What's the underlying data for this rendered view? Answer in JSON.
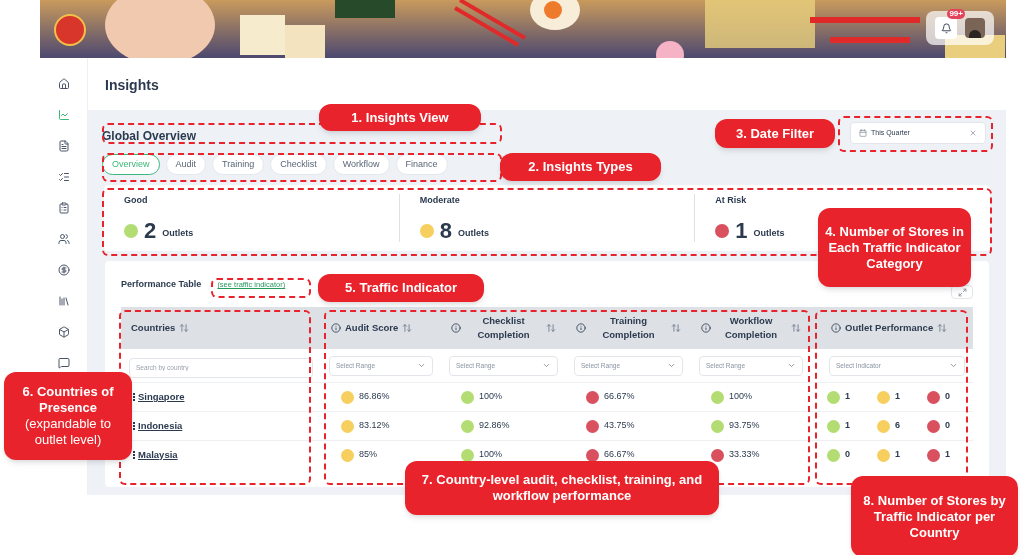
{
  "header": {
    "notification_badge": "99+"
  },
  "sidebar": {
    "items": [
      {
        "selected": false
      },
      {
        "selected": true
      },
      {
        "selected": false
      },
      {
        "selected": false
      },
      {
        "selected": false
      },
      {
        "selected": false
      },
      {
        "selected": false
      },
      {
        "selected": false
      },
      {
        "selected": false
      },
      {
        "selected": false
      }
    ]
  },
  "page_title": "Insights",
  "overview": {
    "title": "Global Overview",
    "date_filter": {
      "value": "This Quarter"
    },
    "tabs": [
      {
        "label": "Overview",
        "selected": true
      },
      {
        "label": "Audit",
        "selected": false
      },
      {
        "label": "Training",
        "selected": false
      },
      {
        "label": "Checklist",
        "selected": false
      },
      {
        "label": "Workflow",
        "selected": false
      },
      {
        "label": "Finance",
        "selected": false
      }
    ],
    "stats": [
      {
        "label": "Good",
        "count": "2",
        "unit": "Outlets",
        "color": "#b3dd73"
      },
      {
        "label": "Moderate",
        "count": "8",
        "unit": "Outlets",
        "color": "#f6cf5e"
      },
      {
        "label": "At Risk",
        "count": "1",
        "unit": "Outlets",
        "color": "#d9505f"
      }
    ]
  },
  "performance_table": {
    "title": "Performance Table",
    "link": "(see traffic indicator)",
    "columns": [
      {
        "label": "Countries",
        "info": false
      },
      {
        "label": "Audit Score",
        "info": true
      },
      {
        "label": "Checklist Completion",
        "info": true
      },
      {
        "label": "Training Completion",
        "info": true
      },
      {
        "label": "Workflow Completion",
        "info": true
      },
      {
        "label": "Outlet Performance",
        "info": true
      }
    ],
    "filters": [
      {
        "kind": "search",
        "placeholder": "Search by country"
      },
      {
        "kind": "select",
        "placeholder": "Select Range"
      },
      {
        "kind": "select",
        "placeholder": "Select Range"
      },
      {
        "kind": "select",
        "placeholder": "Select Range"
      },
      {
        "kind": "select",
        "placeholder": "Select Range"
      },
      {
        "kind": "select",
        "placeholder": "Select Indicator"
      }
    ],
    "rows": [
      {
        "cells": [
          {
            "kind": "country",
            "value": "Singapore"
          },
          {
            "kind": "metric",
            "value": "86.86%",
            "color": "#f6cf5e"
          },
          {
            "kind": "metric",
            "value": "100%",
            "color": "#b3dd73"
          },
          {
            "kind": "metric",
            "value": "66.67%",
            "color": "#d9505f"
          },
          {
            "kind": "metric",
            "value": "100%",
            "color": "#b3dd73"
          },
          {
            "kind": "outlets",
            "counts": [
              {
                "count": "1",
                "color": "#b3dd73"
              },
              {
                "count": "1",
                "color": "#f6cf5e"
              },
              {
                "count": "0",
                "color": "#d9505f"
              }
            ]
          }
        ]
      },
      {
        "cells": [
          {
            "kind": "country",
            "value": "Indonesia"
          },
          {
            "kind": "metric",
            "value": "83.12%",
            "color": "#f6cf5e"
          },
          {
            "kind": "metric",
            "value": "92.86%",
            "color": "#b3dd73"
          },
          {
            "kind": "metric",
            "value": "43.75%",
            "color": "#d9505f"
          },
          {
            "kind": "metric",
            "value": "93.75%",
            "color": "#b3dd73"
          },
          {
            "kind": "outlets",
            "counts": [
              {
                "count": "1",
                "color": "#b3dd73"
              },
              {
                "count": "6",
                "color": "#f6cf5e"
              },
              {
                "count": "0",
                "color": "#d9505f"
              }
            ]
          }
        ]
      },
      {
        "cells": [
          {
            "kind": "country",
            "value": "Malaysia"
          },
          {
            "kind": "metric",
            "value": "85%",
            "color": "#f6cf5e"
          },
          {
            "kind": "metric",
            "value": "100%",
            "color": "#b3dd73"
          },
          {
            "kind": "metric",
            "value": "66.67%",
            "color": "#d9505f"
          },
          {
            "kind": "metric",
            "value": "33.33%",
            "color": "#d9505f"
          },
          {
            "kind": "outlets",
            "counts": [
              {
                "count": "0",
                "color": "#b3dd73"
              },
              {
                "count": "1",
                "color": "#f6cf5e"
              },
              {
                "count": "1",
                "color": "#d9505f"
              }
            ]
          }
        ]
      }
    ]
  },
  "annotations": [
    {
      "text": "1. Insights View"
    },
    {
      "text": "2. Insights Types"
    },
    {
      "text": "3. Date Filter"
    },
    {
      "text": "4. Number of Stores in Each Traffic Indicator Category"
    },
    {
      "text": "5. Traffic Indicator"
    },
    {
      "text": "**6. Countries of Presence** (expandable to outlet level)"
    },
    {
      "text": "7. Country-level audit, checklist, training, and workflow performance"
    },
    {
      "text": "8. Number of Stores by Traffic Indicator per Country"
    }
  ]
}
